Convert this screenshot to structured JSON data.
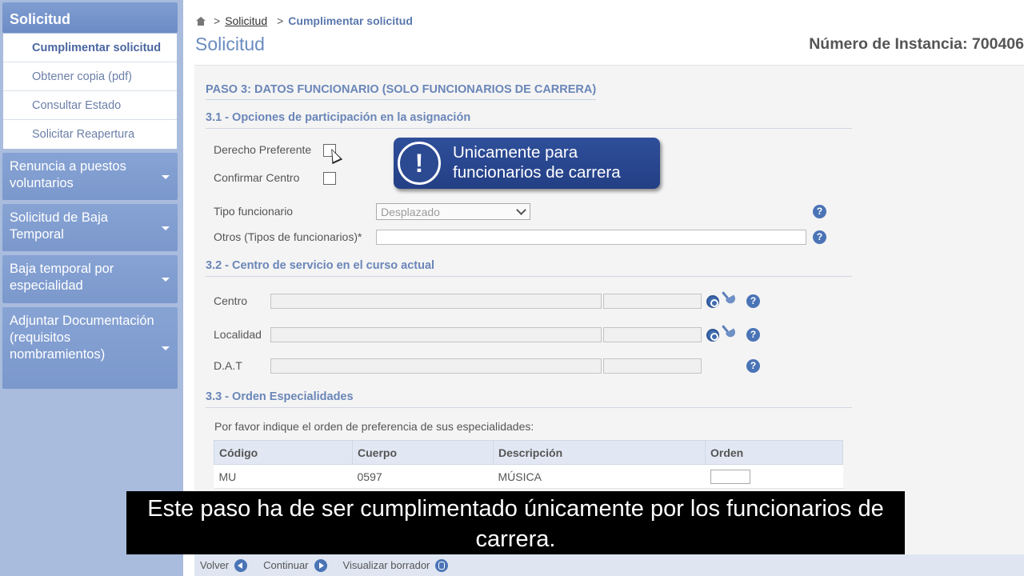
{
  "sidebar": {
    "header": "Solicitud",
    "sub_items": [
      {
        "label": "Cumplimentar solicitud",
        "active": true
      },
      {
        "label": "Obtener copia (pdf)"
      },
      {
        "label": "Consultar Estado"
      },
      {
        "label": "Solicitar Reapertura"
      }
    ],
    "groups": [
      {
        "label": "Renuncia a puestos voluntarios"
      },
      {
        "label": "Solicitud de Baja Temporal"
      },
      {
        "label": "Baja temporal por especialidad"
      },
      {
        "label": "Adjuntar Documentación (requisitos nombramientos)"
      }
    ]
  },
  "breadcrumb": {
    "separator": ">",
    "link": "Solicitud",
    "current": "Cumplimentar solicitud"
  },
  "page": {
    "title": "Solicitud",
    "instance": "Número de Instancia: 700406"
  },
  "form": {
    "step_title": "PASO 3: DATOS FUNCIONARIO (SOLO FUNCIONARIOS DE CARRERA)",
    "section1": {
      "title": "3.1 - Opciones de participación en la asignación",
      "derecho_label": "Derecho Preferente",
      "confirmar_label": "Confirmar Centro",
      "tipo_label": "Tipo funcionario",
      "tipo_value": "Desplazado",
      "otros_label": "Otros (Tipos de funcionarios)*"
    },
    "section2": {
      "title": "3.2 - Centro de servicio en el curso actual",
      "centro_label": "Centro",
      "localidad_label": "Localidad",
      "dat_label": "D.A.T"
    },
    "section3": {
      "title": "3.3 - Orden Especialidades",
      "instruction": "Por favor indique el orden de preferencia de sus especialidades:",
      "columns": [
        "Código",
        "Cuerpo",
        "Descripción",
        "Orden"
      ],
      "rows": [
        {
          "codigo": "MU",
          "cuerpo": "0597",
          "descripcion": "MÚSICA"
        }
      ]
    }
  },
  "help_glyph": "?",
  "bottom_bar": {
    "volver": "Volver",
    "continuar": "Continuar",
    "visualizar": "Visualizar borrador"
  },
  "callout": {
    "icon_glyph": "!",
    "line1": "Unicamente para",
    "line2": "funcionarios de carrera"
  },
  "subtitle": {
    "line1": "Este paso ha de ser cumplimentado únicamente por los funcionarios de",
    "line2": "carrera."
  }
}
